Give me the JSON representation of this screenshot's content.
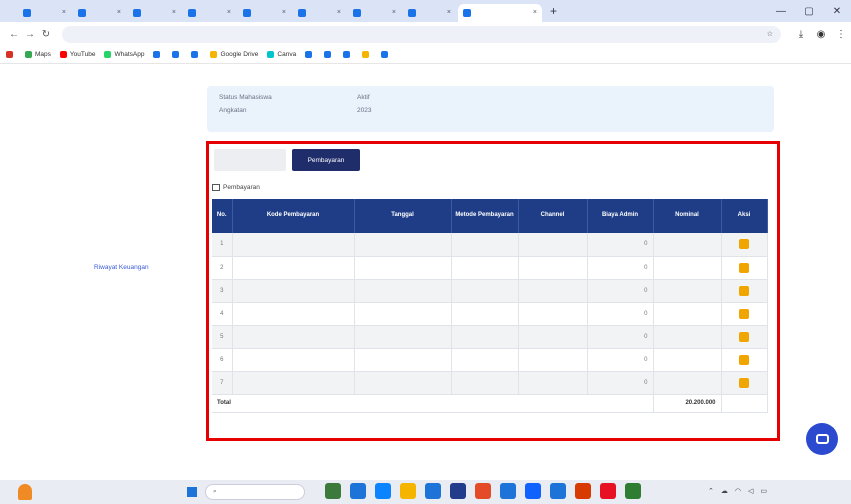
{
  "browser": {
    "tabs": [
      {
        "label": "",
        "color": "#1a73e8"
      },
      {
        "label": "",
        "color": "#1a73e8"
      },
      {
        "label": "",
        "color": "#1a73e8"
      },
      {
        "label": "",
        "color": "#1a73e8"
      },
      {
        "label": "",
        "color": "#1a73e8"
      },
      {
        "label": "",
        "color": "#1a73e8"
      },
      {
        "label": "",
        "color": "#1a73e8"
      },
      {
        "label": "",
        "color": "#1a73e8"
      },
      {
        "label": "",
        "color": "#1a73e8"
      }
    ],
    "url": "",
    "bookmarks": [
      {
        "label": "",
        "color": "#d93025"
      },
      {
        "label": "Maps",
        "color": "#34a853"
      },
      {
        "label": "YouTube",
        "color": "#ff0000"
      },
      {
        "label": "WhatsApp",
        "color": "#25d366"
      },
      {
        "label": "",
        "color": "#1a73e8"
      },
      {
        "label": "",
        "color": "#1a73e8"
      },
      {
        "label": "",
        "color": "#1a73e8"
      },
      {
        "label": "Google Drive",
        "color": "#f4b400"
      },
      {
        "label": "Canva",
        "color": "#00c4cc"
      },
      {
        "label": "",
        "color": "#1a73e8"
      },
      {
        "label": "",
        "color": "#1a73e8"
      },
      {
        "label": "",
        "color": "#1a73e8"
      },
      {
        "label": "",
        "color": "#f4b400"
      },
      {
        "label": "",
        "color": "#1a73e8"
      }
    ]
  },
  "sidebar": {
    "items": [
      {
        "label": ""
      },
      {
        "label": ""
      },
      {
        "label": ""
      },
      {
        "label": ""
      },
      {
        "label": ""
      },
      {
        "label": ""
      },
      {
        "label": ""
      },
      {
        "label": "Riwayat Keuangan",
        "active": true
      },
      {
        "label": ""
      },
      {
        "label": ""
      },
      {
        "label": ""
      },
      {
        "label": ""
      },
      {
        "label": ""
      },
      {
        "label": ""
      },
      {
        "label": ""
      }
    ]
  },
  "student_info": {
    "status_label": "Status Mahasiswa",
    "status_value": "Aktif",
    "angkatan_label": "Angkatan",
    "angkatan_value": "2023",
    "sks_lulus_label": "",
    "sks_lulus_value": "",
    "total_sks_label": "",
    "total_sks_value": ""
  },
  "subtabs": {
    "tagihan": "",
    "pembayaran": "Pembayaran"
  },
  "section_title": "Pembayaran",
  "table": {
    "headers": [
      "No.",
      "Kode Pembayaran",
      "Tanggal",
      "Metode Pembayaran",
      "Channel",
      "Biaya Admin",
      "Nominal",
      "Aksi"
    ],
    "rows": [
      {
        "no": "1",
        "kode": "",
        "tanggal": "",
        "metode": "",
        "channel": "",
        "admin": "0",
        "nominal": ""
      },
      {
        "no": "2",
        "kode": "",
        "tanggal": "",
        "metode": "",
        "channel": "",
        "admin": "0",
        "nominal": ""
      },
      {
        "no": "3",
        "kode": "",
        "tanggal": "",
        "metode": "",
        "channel": "",
        "admin": "0",
        "nominal": ""
      },
      {
        "no": "4",
        "kode": "",
        "tanggal": "",
        "metode": "",
        "channel": "",
        "admin": "0",
        "nominal": ""
      },
      {
        "no": "5",
        "kode": "",
        "tanggal": "",
        "metode": "",
        "channel": "",
        "admin": "0",
        "nominal": ""
      },
      {
        "no": "6",
        "kode": "",
        "tanggal": "",
        "metode": "",
        "channel": "",
        "admin": "0",
        "nominal": ""
      },
      {
        "no": "7",
        "kode": "",
        "tanggal": "",
        "metode": "",
        "channel": "",
        "admin": "0",
        "nominal": ""
      }
    ],
    "total_label": "Total",
    "total_value": "20.200.000"
  },
  "below_section": "",
  "taskbar": {
    "search_placeholder": "",
    "apps": [
      "#3b7a3b",
      "#1e73d8",
      "#0a84ff",
      "#f4b400",
      "#1e73d8",
      "#223c8c",
      "#e34c26",
      "#1e73d8",
      "#0f62fe",
      "#1e73d8",
      "#d83b01",
      "#e81123",
      "#2e7d32"
    ],
    "clock_time": "",
    "clock_date": ""
  }
}
